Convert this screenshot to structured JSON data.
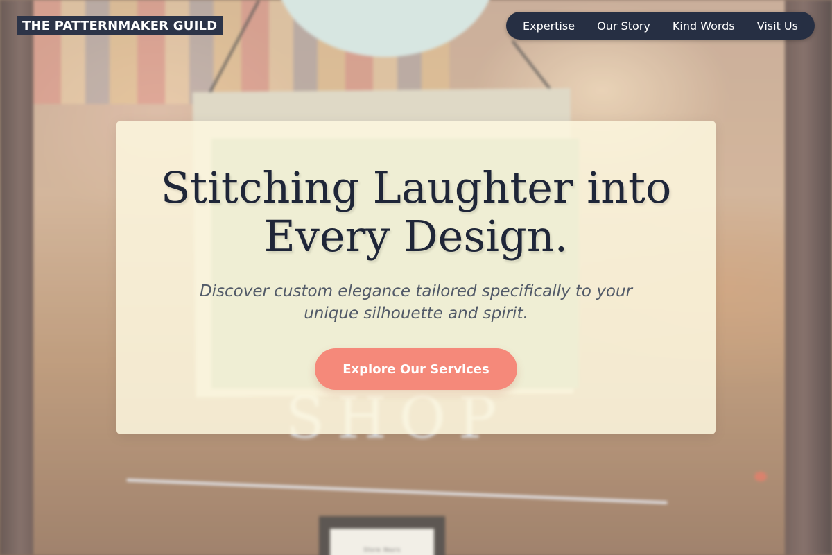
{
  "header": {
    "brand": "THE PATTERNMAKER GUILD",
    "nav": [
      {
        "label": "Expertise"
      },
      {
        "label": "Our Story"
      },
      {
        "label": "Kind Words"
      },
      {
        "label": "Visit Us"
      }
    ]
  },
  "hero": {
    "title_line1": "Stitching Laughter into",
    "title_line2": "Every Design.",
    "subtitle": "Discover custom elegance tailored specifically to your unique silhouette and spirit.",
    "cta_label": "Explore Our Services"
  },
  "background": {
    "sign_text": "SHOP",
    "hours_text": "Store Hours"
  },
  "colors": {
    "nav_background": "#262f43",
    "brand_background": "#2c3448",
    "cta": "#f5897a",
    "hero_card": "#fdf7de",
    "title": "#1f2638"
  }
}
